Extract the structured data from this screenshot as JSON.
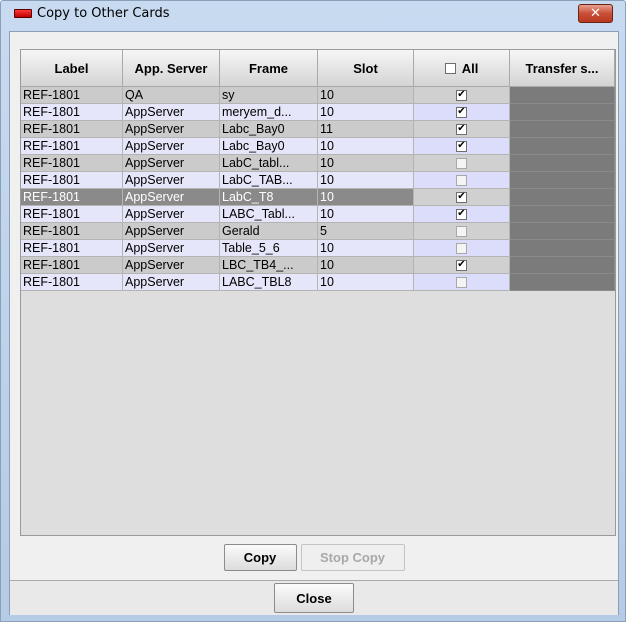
{
  "window": {
    "title": "Copy to Other Cards",
    "close_glyph": "✕"
  },
  "table": {
    "headers": [
      "Label",
      "App. Server",
      "Frame",
      "Slot",
      "All",
      "Transfer s..."
    ],
    "rows": [
      {
        "label": "REF-1801",
        "server": "QA",
        "frame": "sy",
        "slot": "10",
        "checked": true,
        "check": "✔"
      },
      {
        "label": "REF-1801",
        "server": "AppServer",
        "frame": "meryem_d...",
        "slot": "10",
        "checked": true,
        "check": "✔"
      },
      {
        "label": "REF-1801",
        "server": "AppServer",
        "frame": "Labc_Bay0",
        "slot": "11",
        "checked": true,
        "check": "✔"
      },
      {
        "label": "REF-1801",
        "server": "AppServer",
        "frame": "Labc_Bay0",
        "slot": "10",
        "checked": true,
        "check": "✔"
      },
      {
        "label": "REF-1801",
        "server": "AppServer",
        "frame": "LabC_tabl...",
        "slot": "10",
        "checked": false,
        "check": ""
      },
      {
        "label": "REF-1801",
        "server": "AppServer",
        "frame": "LabC_TAB...",
        "slot": "10",
        "checked": false,
        "check": ""
      },
      {
        "label": "REF-1801",
        "server": "AppServer",
        "frame": "LabC_T8",
        "slot": "10",
        "checked": true,
        "check": "✔",
        "selected": true
      },
      {
        "label": "REF-1801",
        "server": "AppServer",
        "frame": "LABC_Tabl...",
        "slot": "10",
        "checked": true,
        "check": "✔"
      },
      {
        "label": "REF-1801",
        "server": "AppServer",
        "frame": "Gerald",
        "slot": "5",
        "checked": false,
        "check": ""
      },
      {
        "label": "REF-1801",
        "server": "AppServer",
        "frame": "Table_5_6",
        "slot": "10",
        "checked": false,
        "check": ""
      },
      {
        "label": "REF-1801",
        "server": "AppServer",
        "frame": "LBC_TB4_...",
        "slot": "10",
        "checked": true,
        "check": "✔"
      },
      {
        "label": "REF-1801",
        "server": "AppServer",
        "frame": "LABC_TBL8",
        "slot": "10",
        "checked": false,
        "check": ""
      }
    ]
  },
  "buttons": {
    "copy": "Copy",
    "stop_copy": "Stop Copy",
    "close": "Close"
  },
  "colors": {
    "transfer_cell": "#7b7b7b",
    "selected_row": "#8a8a8a",
    "title_icon": "#e01010",
    "close_button": "#c94f37"
  }
}
